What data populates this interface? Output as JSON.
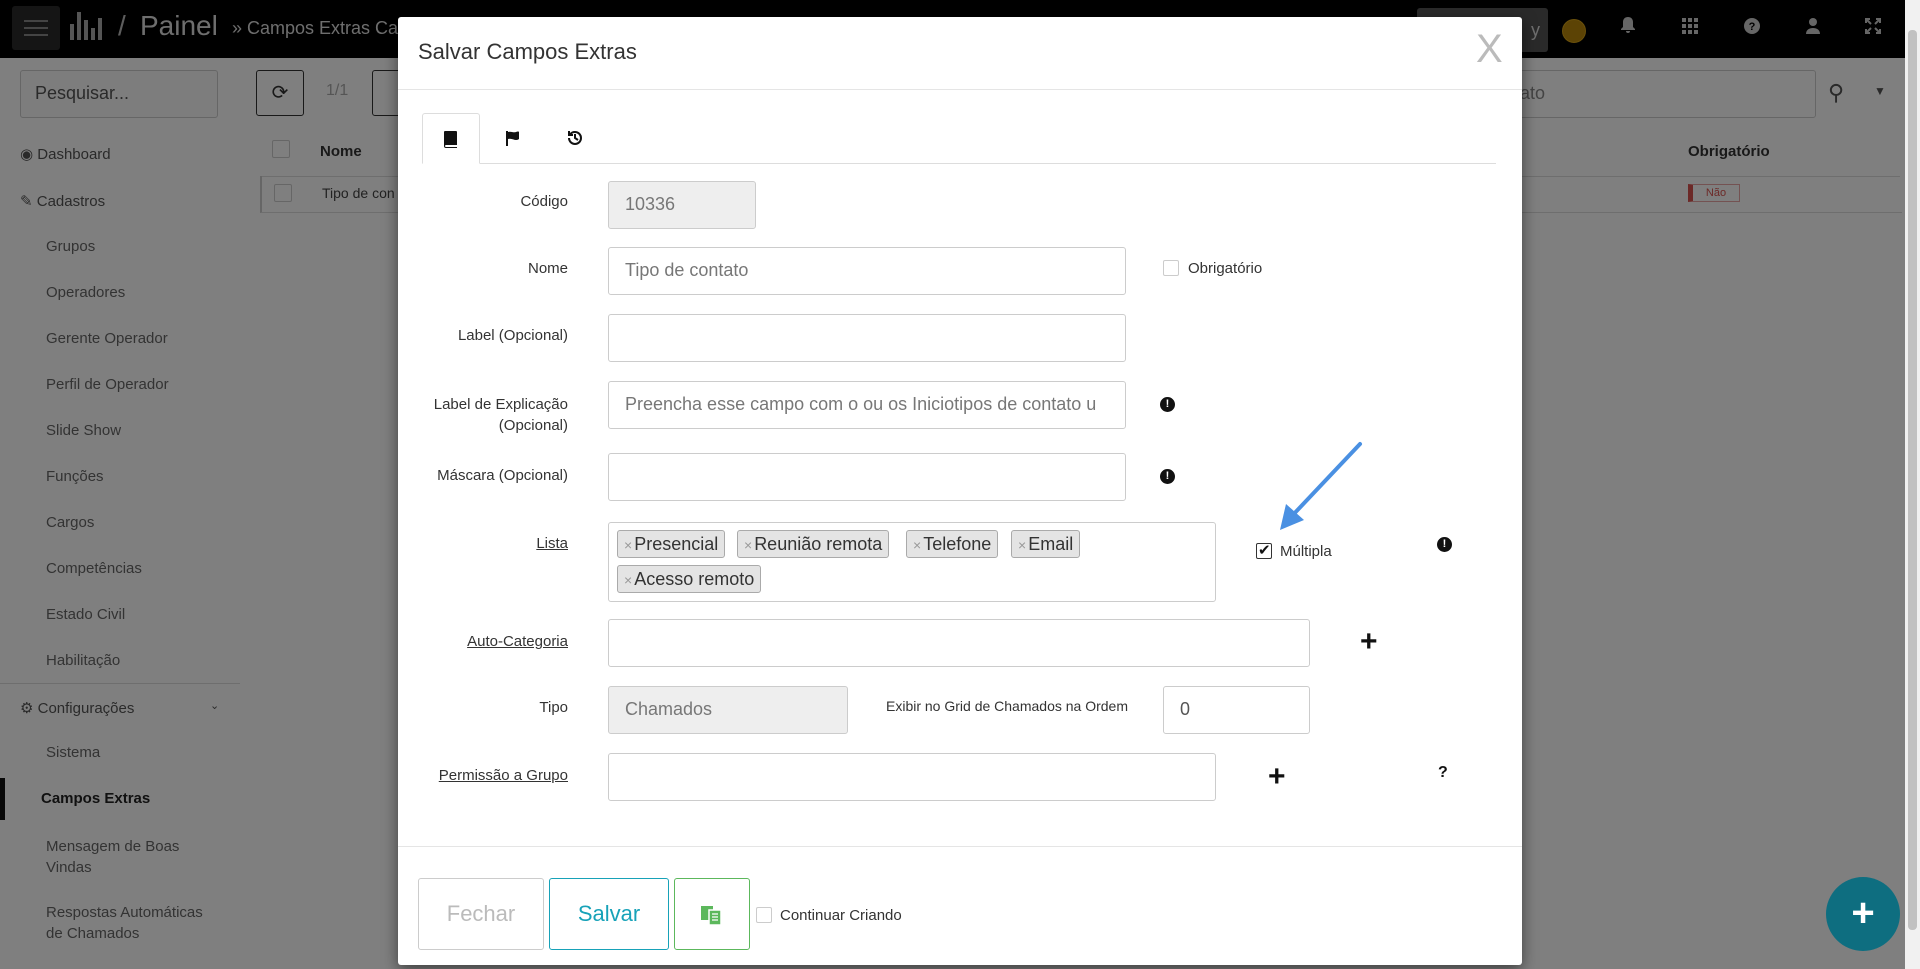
{
  "topbar": {
    "title": "Painel",
    "separator": "/",
    "subtitle": "» Campos Extras Ca",
    "ghost_button": "y"
  },
  "sidebar": {
    "search_placeholder": "Pesquisar...",
    "items": [
      {
        "label": "Dashboard"
      },
      {
        "label": "Cadastros"
      },
      {
        "label": "Grupos"
      },
      {
        "label": "Operadores"
      },
      {
        "label": "Gerente Operador"
      },
      {
        "label": "Perfil de Operador"
      },
      {
        "label": "Slide Show"
      },
      {
        "label": "Funções"
      },
      {
        "label": "Cargos"
      },
      {
        "label": "Competências"
      },
      {
        "label": "Estado Civil"
      },
      {
        "label": "Habilitação"
      },
      {
        "label": "Configurações"
      },
      {
        "label": "Sistema"
      },
      {
        "label": "Campos Extras"
      },
      {
        "label": "Mensagem de Boas Vindas"
      },
      {
        "label": "Respostas Automáticas de Chamados"
      }
    ]
  },
  "background": {
    "pagination": "1/1",
    "search_value": "ontato",
    "columns": {
      "name": "Nome",
      "required": "Obrigatório"
    },
    "row": {
      "name": "Tipo de con",
      "required": "Não"
    }
  },
  "modal": {
    "title": "Salvar Campos Extras",
    "close": "X",
    "tabs": [
      {
        "icon": "book-icon"
      },
      {
        "icon": "flag-icon"
      },
      {
        "icon": "history-icon"
      }
    ],
    "fields": {
      "codigo": {
        "label": "Código",
        "value": "10336"
      },
      "nome": {
        "label": "Nome",
        "placeholder": "Tipo de contato"
      },
      "obrigatorio": {
        "label": "Obrigatório",
        "checked": false
      },
      "label_opcional": {
        "label": "Label (Opcional)",
        "value": ""
      },
      "label_explicacao": {
        "label": "Label de Explicação (Opcional)",
        "placeholder": "Preencha esse campo com o ou os Iniciotipos de contato u"
      },
      "mascara": {
        "label": "Máscara (Opcional)",
        "value": ""
      },
      "lista": {
        "label": "Lista",
        "tags": [
          "Presencial",
          "Reunião remota",
          "Telefone",
          "Email",
          "Acesso remoto"
        ],
        "remove_glyph": "×"
      },
      "multipla": {
        "label": "Múltipla",
        "checked": true
      },
      "auto_categoria": {
        "label": "Auto-Categoria",
        "value": ""
      },
      "tipo": {
        "label": "Tipo",
        "value": "Chamados"
      },
      "exibir_ordem": {
        "label": "Exibir no Grid de Chamados na Ordem",
        "value": "0"
      },
      "permissao_grupo": {
        "label": "Permissão a Grupo",
        "value": ""
      }
    },
    "footer": {
      "close_label": "Fechar",
      "save_label": "Salvar",
      "continue_label": "Continuar Criando",
      "continue_checked": false
    }
  },
  "colors": {
    "save": "#17a2b8",
    "copy": "#5cb85c",
    "arrow": "#4a90e2",
    "fab": "#0e6e80",
    "badge_no": "#d9534f"
  }
}
